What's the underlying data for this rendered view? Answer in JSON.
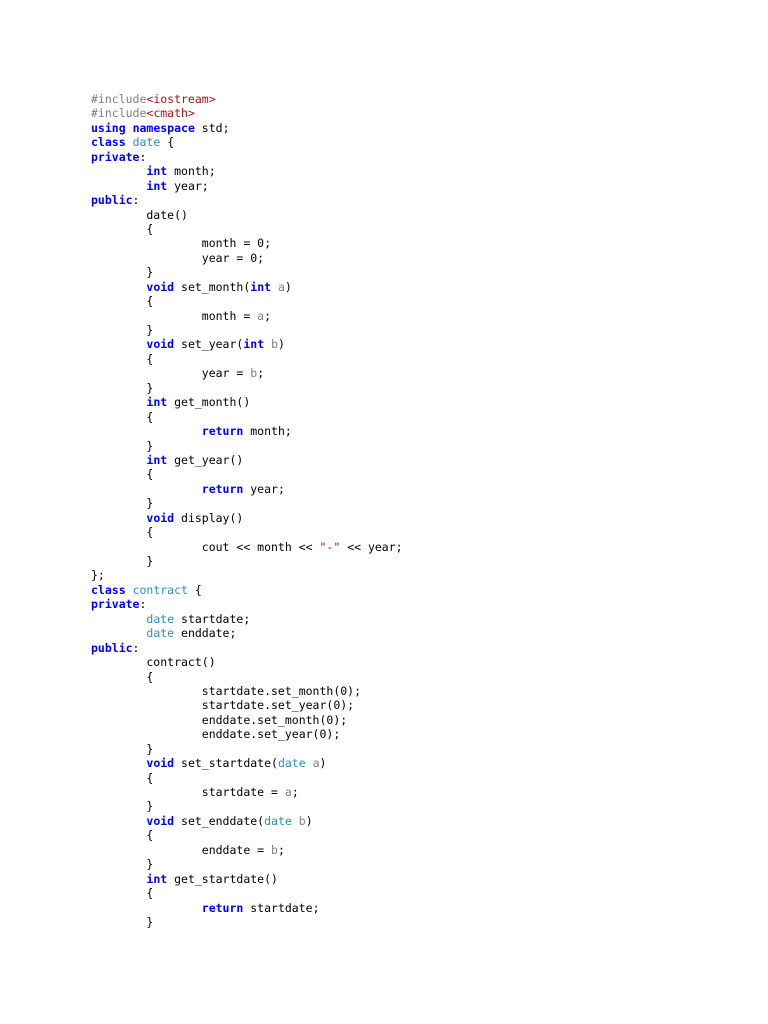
{
  "document": {
    "language": "cpp",
    "colors": {
      "keyword": "#0000ff",
      "preprocessor": "#808080",
      "header": "#a31515",
      "type": "#2b91af",
      "parameter": "#808080",
      "string": "#a31515",
      "identifier": "#000000"
    },
    "lines": [
      [
        {
          "t": "#include",
          "k": "pp"
        },
        {
          "t": "<iostream>",
          "k": "hdr"
        }
      ],
      [
        {
          "t": "#include",
          "k": "pp"
        },
        {
          "t": "<cmath>",
          "k": "hdr"
        }
      ],
      [
        {
          "t": "using",
          "k": "kw"
        },
        {
          "t": " ",
          "k": "plain"
        },
        {
          "t": "namespace",
          "k": "kw"
        },
        {
          "t": " std;",
          "k": "plain"
        }
      ],
      [
        {
          "t": "class",
          "k": "kw"
        },
        {
          "t": " ",
          "k": "plain"
        },
        {
          "t": "date",
          "k": "type"
        },
        {
          "t": " {",
          "k": "plain"
        }
      ],
      [
        {
          "t": "private",
          "k": "kw"
        },
        {
          "t": ":",
          "k": "plain"
        }
      ],
      [
        {
          "t": "        ",
          "k": "plain"
        },
        {
          "t": "int",
          "k": "kw"
        },
        {
          "t": " month;",
          "k": "plain"
        }
      ],
      [
        {
          "t": "        ",
          "k": "plain"
        },
        {
          "t": "int",
          "k": "kw"
        },
        {
          "t": " year;",
          "k": "plain"
        }
      ],
      [
        {
          "t": "public",
          "k": "kw"
        },
        {
          "t": ":",
          "k": "plain"
        }
      ],
      [
        {
          "t": "        date()",
          "k": "plain"
        }
      ],
      [
        {
          "t": "        {",
          "k": "plain"
        }
      ],
      [
        {
          "t": "                month = 0;",
          "k": "plain"
        }
      ],
      [
        {
          "t": "                year = 0;",
          "k": "plain"
        }
      ],
      [
        {
          "t": "        }",
          "k": "plain"
        }
      ],
      [
        {
          "t": "        ",
          "k": "plain"
        },
        {
          "t": "void",
          "k": "kw"
        },
        {
          "t": " set_month(",
          "k": "plain"
        },
        {
          "t": "int",
          "k": "kw"
        },
        {
          "t": " ",
          "k": "plain"
        },
        {
          "t": "a",
          "k": "param"
        },
        {
          "t": ")",
          "k": "plain"
        }
      ],
      [
        {
          "t": "        {",
          "k": "plain"
        }
      ],
      [
        {
          "t": "                month = ",
          "k": "plain"
        },
        {
          "t": "a",
          "k": "param"
        },
        {
          "t": ";",
          "k": "plain"
        }
      ],
      [
        {
          "t": "        }",
          "k": "plain"
        }
      ],
      [
        {
          "t": "        ",
          "k": "plain"
        },
        {
          "t": "void",
          "k": "kw"
        },
        {
          "t": " set_year(",
          "k": "plain"
        },
        {
          "t": "int",
          "k": "kw"
        },
        {
          "t": " ",
          "k": "plain"
        },
        {
          "t": "b",
          "k": "param"
        },
        {
          "t": ")",
          "k": "plain"
        }
      ],
      [
        {
          "t": "        {",
          "k": "plain"
        }
      ],
      [
        {
          "t": "                year = ",
          "k": "plain"
        },
        {
          "t": "b",
          "k": "param"
        },
        {
          "t": ";",
          "k": "plain"
        }
      ],
      [
        {
          "t": "        }",
          "k": "plain"
        }
      ],
      [
        {
          "t": "        ",
          "k": "plain"
        },
        {
          "t": "int",
          "k": "kw"
        },
        {
          "t": " get_month()",
          "k": "plain"
        }
      ],
      [
        {
          "t": "        {",
          "k": "plain"
        }
      ],
      [
        {
          "t": "                ",
          "k": "plain"
        },
        {
          "t": "return",
          "k": "kw"
        },
        {
          "t": " month;",
          "k": "plain"
        }
      ],
      [
        {
          "t": "        }",
          "k": "plain"
        }
      ],
      [
        {
          "t": "        ",
          "k": "plain"
        },
        {
          "t": "int",
          "k": "kw"
        },
        {
          "t": " get_year()",
          "k": "plain"
        }
      ],
      [
        {
          "t": "        {",
          "k": "plain"
        }
      ],
      [
        {
          "t": "                ",
          "k": "plain"
        },
        {
          "t": "return",
          "k": "kw"
        },
        {
          "t": " year;",
          "k": "plain"
        }
      ],
      [
        {
          "t": "        }",
          "k": "plain"
        }
      ],
      [
        {
          "t": "        ",
          "k": "plain"
        },
        {
          "t": "void",
          "k": "kw"
        },
        {
          "t": " display()",
          "k": "plain"
        }
      ],
      [
        {
          "t": "        {",
          "k": "plain"
        }
      ],
      [
        {
          "t": "                cout << month << ",
          "k": "plain"
        },
        {
          "t": "\"-\"",
          "k": "str"
        },
        {
          "t": " << year;",
          "k": "plain"
        }
      ],
      [
        {
          "t": "        }",
          "k": "plain"
        }
      ],
      [
        {
          "t": "};",
          "k": "plain"
        }
      ],
      [
        {
          "t": "class",
          "k": "kw"
        },
        {
          "t": " ",
          "k": "plain"
        },
        {
          "t": "contract",
          "k": "type"
        },
        {
          "t": " {",
          "k": "plain"
        }
      ],
      [
        {
          "t": "private",
          "k": "kw"
        },
        {
          "t": ":",
          "k": "plain"
        }
      ],
      [
        {
          "t": "        ",
          "k": "plain"
        },
        {
          "t": "date",
          "k": "type"
        },
        {
          "t": " startdate;",
          "k": "plain"
        }
      ],
      [
        {
          "t": "        ",
          "k": "plain"
        },
        {
          "t": "date",
          "k": "type"
        },
        {
          "t": " enddate;",
          "k": "plain"
        }
      ],
      [
        {
          "t": "public",
          "k": "kw"
        },
        {
          "t": ":",
          "k": "plain"
        }
      ],
      [
        {
          "t": "        contract()",
          "k": "plain"
        }
      ],
      [
        {
          "t": "        {",
          "k": "plain"
        }
      ],
      [
        {
          "t": "                startdate.set_month(0);",
          "k": "plain"
        }
      ],
      [
        {
          "t": "                startdate.set_year(0);",
          "k": "plain"
        }
      ],
      [
        {
          "t": "                enddate.set_month(0);",
          "k": "plain"
        }
      ],
      [
        {
          "t": "                enddate.set_year(0);",
          "k": "plain"
        }
      ],
      [
        {
          "t": "        }",
          "k": "plain"
        }
      ],
      [
        {
          "t": "        ",
          "k": "plain"
        },
        {
          "t": "void",
          "k": "kw"
        },
        {
          "t": " set_startdate(",
          "k": "plain"
        },
        {
          "t": "date",
          "k": "type"
        },
        {
          "t": " ",
          "k": "plain"
        },
        {
          "t": "a",
          "k": "param"
        },
        {
          "t": ")",
          "k": "plain"
        }
      ],
      [
        {
          "t": "        {",
          "k": "plain"
        }
      ],
      [
        {
          "t": "                startdate = ",
          "k": "plain"
        },
        {
          "t": "a",
          "k": "param"
        },
        {
          "t": ";",
          "k": "plain"
        }
      ],
      [
        {
          "t": "        }",
          "k": "plain"
        }
      ],
      [
        {
          "t": "        ",
          "k": "plain"
        },
        {
          "t": "void",
          "k": "kw"
        },
        {
          "t": " set_enddate(",
          "k": "plain"
        },
        {
          "t": "date",
          "k": "type"
        },
        {
          "t": " ",
          "k": "plain"
        },
        {
          "t": "b",
          "k": "param"
        },
        {
          "t": ")",
          "k": "plain"
        }
      ],
      [
        {
          "t": "        {",
          "k": "plain"
        }
      ],
      [
        {
          "t": "                enddate = ",
          "k": "plain"
        },
        {
          "t": "b",
          "k": "param"
        },
        {
          "t": ";",
          "k": "plain"
        }
      ],
      [
        {
          "t": "        }",
          "k": "plain"
        }
      ],
      [
        {
          "t": "        ",
          "k": "plain"
        },
        {
          "t": "int",
          "k": "kw"
        },
        {
          "t": " get_startdate()",
          "k": "plain"
        }
      ],
      [
        {
          "t": "        {",
          "k": "plain"
        }
      ],
      [
        {
          "t": "                ",
          "k": "plain"
        },
        {
          "t": "return",
          "k": "kw"
        },
        {
          "t": " startdate;",
          "k": "plain"
        }
      ],
      [
        {
          "t": "        }",
          "k": "plain"
        }
      ]
    ]
  }
}
